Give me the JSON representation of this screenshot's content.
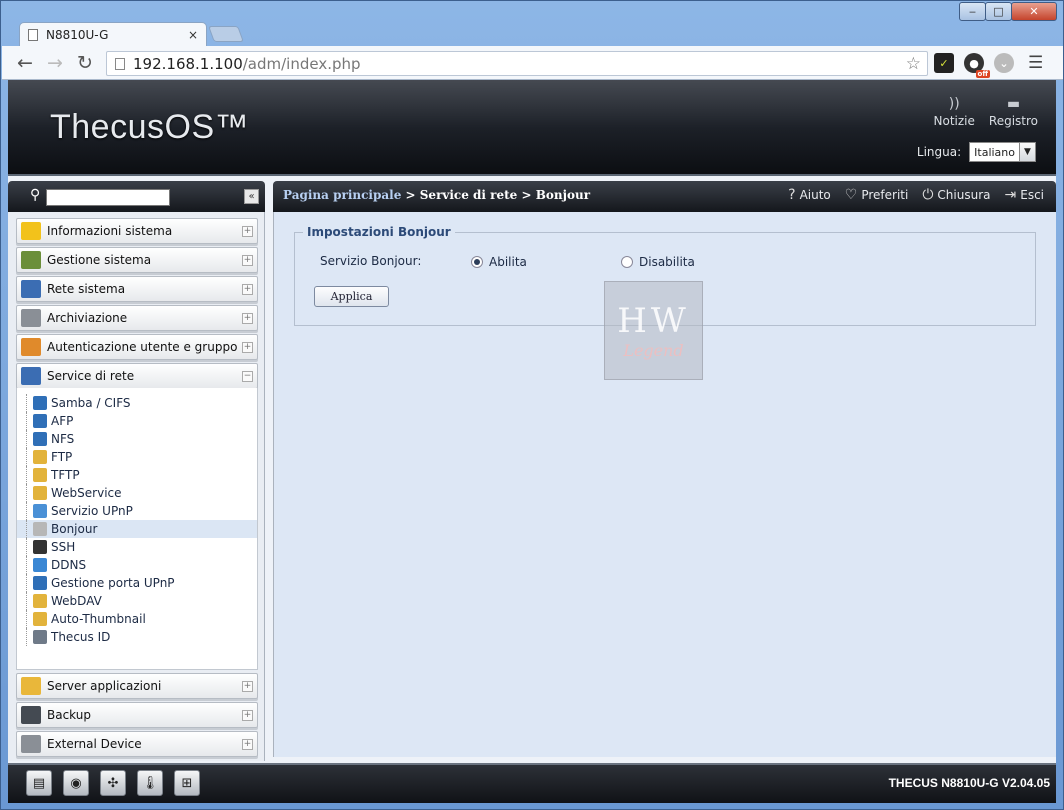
{
  "browser": {
    "tab_title": "N8810U-G",
    "tab_close": "×",
    "url_host": "192.168.1.100",
    "url_path": "/adm/index.php",
    "win_min": "‒",
    "win_max": "□",
    "win_close": "✕",
    "ext_off": "off"
  },
  "header": {
    "logo": "ThecusOS™",
    "news_label": "Notizie",
    "log_label": "Registro",
    "language_label": "Lingua:",
    "language_value": "Italiano"
  },
  "sidebar": {
    "collapse": "«",
    "categories": [
      {
        "label": "Informazioni sistema",
        "toggle": "+",
        "color": "#f2c21b"
      },
      {
        "label": "Gestione sistema",
        "toggle": "+",
        "color": "#6b8f3a"
      },
      {
        "label": "Rete sistema",
        "toggle": "+",
        "color": "#3b6db3"
      },
      {
        "label": "Archiviazione",
        "toggle": "+",
        "color": "#8a8f96"
      },
      {
        "label": "Autenticazione utente e gruppo",
        "toggle": "+",
        "color": "#e08a2b"
      },
      {
        "label": "Service di rete",
        "toggle": "−",
        "color": "#3b6db3"
      },
      {
        "label": "Server applicazioni",
        "toggle": "+",
        "color": "#e9b73a"
      },
      {
        "label": "Backup",
        "toggle": "+",
        "color": "#444a52"
      },
      {
        "label": "External Device",
        "toggle": "+",
        "color": "#8a8f96"
      }
    ],
    "items": [
      {
        "label": "Samba / CIFS",
        "color": "#2f6fb7"
      },
      {
        "label": "AFP",
        "color": "#2f6fb7"
      },
      {
        "label": "NFS",
        "color": "#2f6fb7"
      },
      {
        "label": "FTP",
        "color": "#e2b33b"
      },
      {
        "label": "TFTP",
        "color": "#e2b33b"
      },
      {
        "label": "WebService",
        "color": "#e2b33b"
      },
      {
        "label": "Servizio UPnP",
        "color": "#4a90d6"
      },
      {
        "label": "Bonjour",
        "color": "#b7b7b7"
      },
      {
        "label": "SSH",
        "color": "#333333"
      },
      {
        "label": "DDNS",
        "color": "#3a87d4"
      },
      {
        "label": "Gestione porta UPnP",
        "color": "#2f6fb7"
      },
      {
        "label": "WebDAV",
        "color": "#e2b33b"
      },
      {
        "label": "Auto-Thumbnail",
        "color": "#e2b33b"
      },
      {
        "label": "Thecus ID",
        "color": "#6f7a88"
      }
    ]
  },
  "breadcrumb": {
    "home": "Pagina principale",
    "sep": ">",
    "section": "Service di rete",
    "page": "Bonjour"
  },
  "actions": {
    "help": "Aiuto",
    "favorites": "Preferiti",
    "shutdown": "Chiusura",
    "logout": "Esci"
  },
  "form": {
    "legend": "Impostazioni Bonjour",
    "field_label": "Servizio Bonjour:",
    "enable_label": "Abilita",
    "disable_label": "Disabilita",
    "enable_checked": true,
    "apply_label": "Applica"
  },
  "watermark": {
    "line1": "HW",
    "line2": "Legend"
  },
  "footer": {
    "version": "THECUS N8810U-G V2.04.05"
  }
}
